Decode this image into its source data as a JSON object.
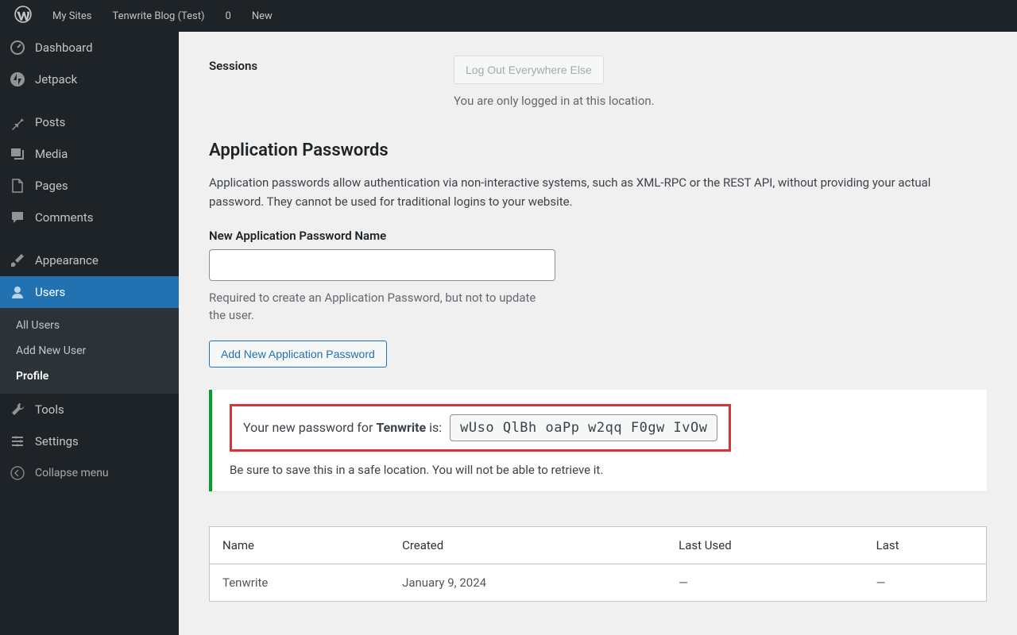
{
  "topbar": {
    "my_sites": "My Sites",
    "site_name": "Tenwrite Blog (Test)",
    "comments_count": "0",
    "new_label": "New"
  },
  "sidebar": {
    "dashboard": "Dashboard",
    "jetpack": "Jetpack",
    "posts": "Posts",
    "media": "Media",
    "pages": "Pages",
    "comments": "Comments",
    "appearance": "Appearance",
    "users": "Users",
    "tools": "Tools",
    "settings": "Settings",
    "collapse": "Collapse menu",
    "submenu": {
      "all_users": "All Users",
      "add_new": "Add New User",
      "profile": "Profile"
    }
  },
  "sessions": {
    "label": "Sessions",
    "button": "Log Out Everywhere Else",
    "help": "You are only logged in at this location."
  },
  "app_passwords": {
    "heading": "Application Passwords",
    "desc": "Application passwords allow authentication via non-interactive systems, such as XML-RPC or the REST API, without providing your actual password. They cannot be used for traditional logins to your website.",
    "field_label": "New Application Password Name",
    "field_help": "Required to create an Application Password, but not to update the user.",
    "add_button": "Add New Application Password"
  },
  "notice": {
    "prefix": "Your new password for ",
    "app_name": "Tenwrite",
    "suffix": " is:",
    "password": "wUso QlBh oaPp w2qq F0gw IvOw",
    "warn": "Be sure to save this in a safe location. You will not be able to retrieve it."
  },
  "table": {
    "col_name": "Name",
    "col_created": "Created",
    "col_last_used": "Last Used",
    "col_last": "Last",
    "row": {
      "name": "Tenwrite",
      "created": "January 9, 2024",
      "last_used": "—",
      "last": "—"
    }
  }
}
